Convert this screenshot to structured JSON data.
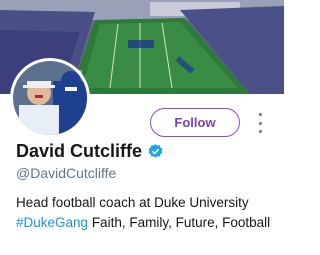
{
  "profile": {
    "name": "David Cutcliffe",
    "handle": "@DavidCutcliffe",
    "verified": true,
    "bio_line1": "Head football coach at Duke University",
    "bio_hashtag": "#DukeGang",
    "bio_rest": " Faith, Family, Future, Football"
  },
  "actions": {
    "follow_label": "Follow"
  },
  "icons": {
    "verified": "verified-badge-icon",
    "more": "more-options-icon"
  },
  "colors": {
    "accent": "#7a3fbf",
    "hashtag": "#1b95e0",
    "verified": "#1da1f2"
  }
}
